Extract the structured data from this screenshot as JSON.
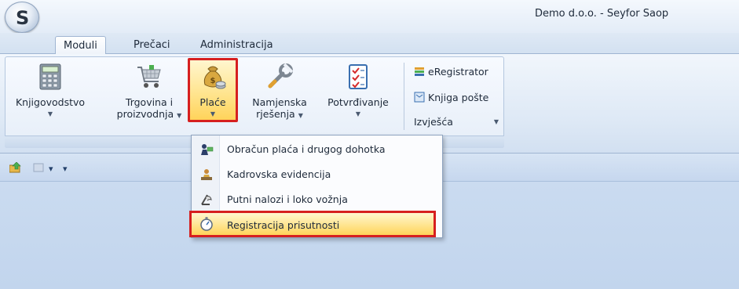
{
  "window": {
    "title": "Demo d.o.o. - Seyfor Saop",
    "logo_letter": "S"
  },
  "tabs": [
    {
      "label": "Moduli",
      "active": true
    },
    {
      "label": "Prečaci",
      "active": false
    },
    {
      "label": "Administracija",
      "active": false
    }
  ],
  "ribbon": {
    "buttons": [
      {
        "line1": "Knjigovodstvo",
        "line2": "",
        "icon": "calculator-icon",
        "has_dropdown": true
      },
      {
        "line1": "Trgovina i",
        "line2": "proizvodnja",
        "icon": "shopping-cart-icon",
        "has_dropdown": true
      },
      {
        "line1": "Plaće",
        "line2": "",
        "icon": "money-bag-icon",
        "has_dropdown": true,
        "highlighted": true
      },
      {
        "line1": "Namjenska",
        "line2": "rješenja",
        "icon": "wrench-icon",
        "has_dropdown": true
      },
      {
        "line1": "Potvrđivanje",
        "line2": "",
        "icon": "checklist-icon",
        "has_dropdown": true
      }
    ],
    "small_buttons": [
      {
        "label": "eRegistrator",
        "icon": "stack-icon"
      },
      {
        "label": "Knjiga pošte",
        "icon": "mail-book-icon"
      },
      {
        "label": "Izvješća",
        "icon": "report-icon",
        "has_dropdown": true
      }
    ]
  },
  "dropdown_menu": {
    "items": [
      {
        "label": "Obračun plaća i drugog dohotka",
        "icon": "payroll-icon"
      },
      {
        "label": "Kadrovska evidencija",
        "icon": "personnel-icon"
      },
      {
        "label": "Putni nalozi i loko vožnja",
        "icon": "travel-icon"
      },
      {
        "label": "Registracija prisutnosti",
        "icon": "stopwatch-icon",
        "highlighted": true
      }
    ]
  },
  "colors": {
    "highlight_border": "#d61f1f",
    "highlight_fill": "#ffe38a",
    "ribbon_bg": "#dde8f5",
    "workspace_bg": "#c6d7ed"
  }
}
